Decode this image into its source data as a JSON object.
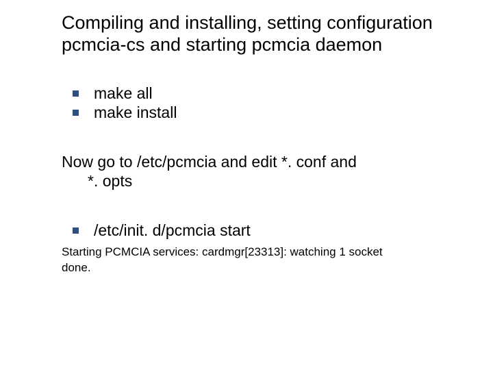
{
  "title": "Compiling and installing, setting configuration pcmcia-cs and starting pcmcia daemon",
  "bullets_top": [
    "make all",
    "make install"
  ],
  "body_line1": "Now go to /etc/pcmcia and edit *. conf and",
  "body_line2": "*. opts",
  "bullets_bottom": [
    "/etc/init. d/pcmcia start"
  ],
  "output_line1": "Starting PCMCIA services: cardmgr[23313]: watching 1 socket",
  "output_line2": "done."
}
